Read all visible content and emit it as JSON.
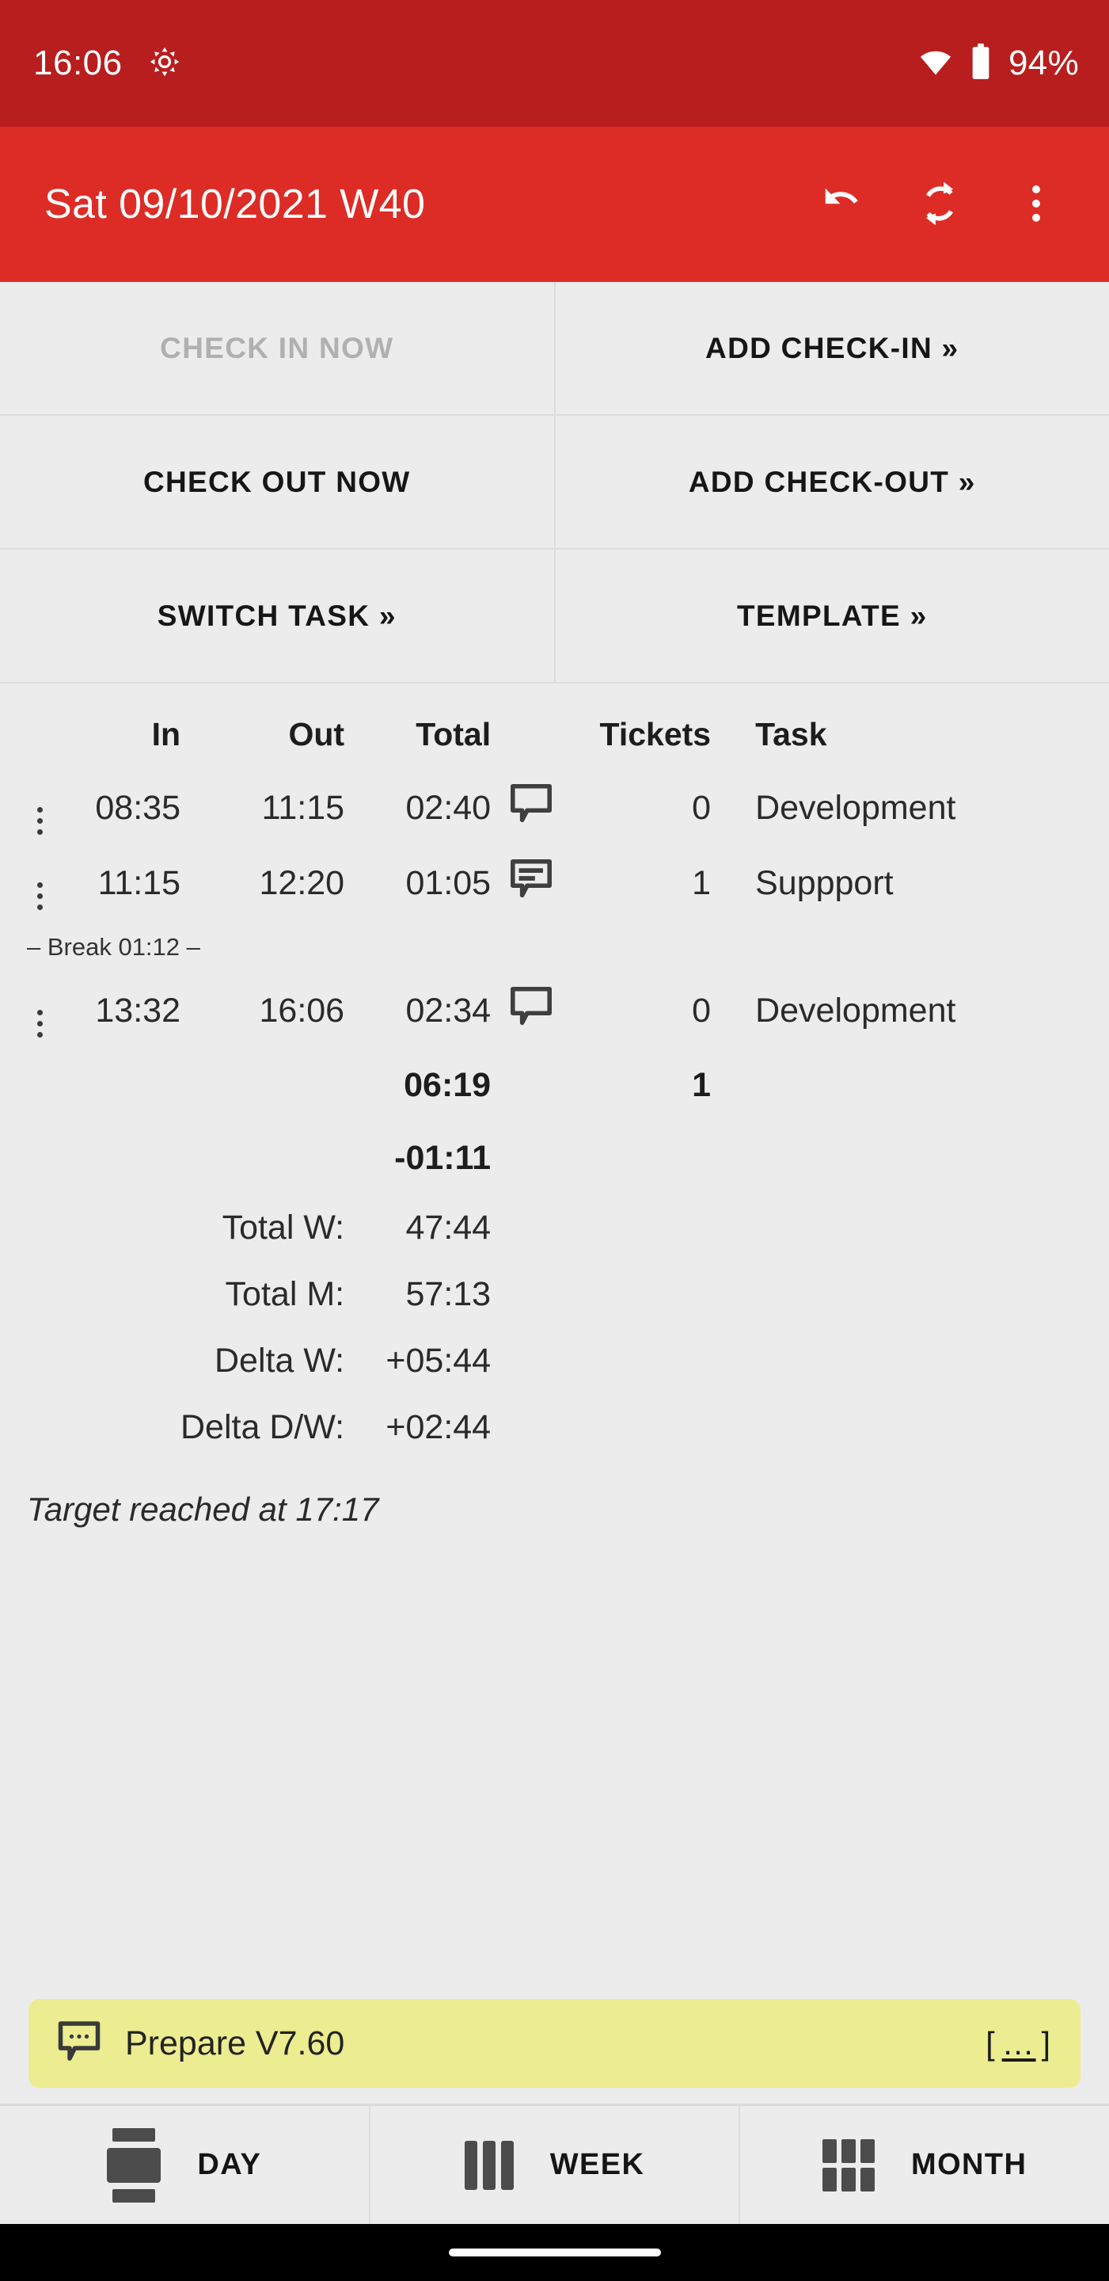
{
  "statusbar": {
    "time": "16:06",
    "brightness_icon": "brightness-icon",
    "wifi_icon": "wifi-icon",
    "battery_icon": "battery-icon",
    "battery_label": "94%"
  },
  "appbar": {
    "title": "Sat 09/10/2021 W40",
    "undo_icon": "undo-icon",
    "sync_icon": "sync-icon",
    "overflow_icon": "overflow-menu-icon",
    "background": "#dd2c26"
  },
  "actions": {
    "buttons": [
      {
        "label": "CHECK IN NOW",
        "disabled": true
      },
      {
        "label": "ADD CHECK-IN »",
        "disabled": false
      },
      {
        "label": "CHECK OUT NOW",
        "disabled": false
      },
      {
        "label": "ADD CHECK-OUT »",
        "disabled": false
      },
      {
        "label": "SWITCH TASK »",
        "disabled": false
      },
      {
        "label": "TEMPLATE »",
        "disabled": false
      }
    ]
  },
  "table": {
    "headers": {
      "in": "In",
      "out": "Out",
      "total": "Total",
      "tickets": "Tickets",
      "task": "Task"
    },
    "rows": [
      {
        "in": "08:35",
        "out": "11:15",
        "total": "02:40",
        "note": "empty",
        "tickets": "0",
        "task": "Development",
        "active": false
      },
      {
        "in": "11:15",
        "out": "12:20",
        "total": "01:05",
        "note": "filled",
        "tickets": "1",
        "task": "Suppport",
        "active": false
      },
      {
        "in": "13:32",
        "out": "16:06",
        "total": "02:34",
        "note": "empty",
        "tickets": "0",
        "task": "Development",
        "active": true
      }
    ],
    "break": "– Break 01:12 –"
  },
  "summary": {
    "day_total": "06:19",
    "day_tickets": "1",
    "day_delta": "-01:11",
    "metrics": [
      {
        "label": "Total W:",
        "value": "47:44",
        "tone": "plain"
      },
      {
        "label": "Total M:",
        "value": "57:13",
        "tone": "plain"
      },
      {
        "label": "Delta W:",
        "value": "+05:44",
        "tone": "positive"
      },
      {
        "label": "Delta D/W:",
        "value": "+02:44",
        "tone": "positive"
      }
    ],
    "target": "Target reached at 17:17"
  },
  "note_banner": {
    "icon": "comment-ellipsis-icon",
    "text": "Prepare V7.60",
    "more_open": "[",
    "more_dots": "…",
    "more_close": "]",
    "background": "#ecec91"
  },
  "bottom_nav": {
    "tabs": [
      {
        "label": "DAY",
        "icon": "day-view-icon"
      },
      {
        "label": "WEEK",
        "icon": "week-view-icon"
      },
      {
        "label": "MONTH",
        "icon": "month-view-icon"
      }
    ]
  },
  "colors": {
    "status_red": "#b81e1e",
    "app_red": "#dd2c26",
    "active_blue": "#0e95cd",
    "negative_red": "#9e1414",
    "positive_green": "#18870f",
    "note_yellow": "#ecec91"
  }
}
